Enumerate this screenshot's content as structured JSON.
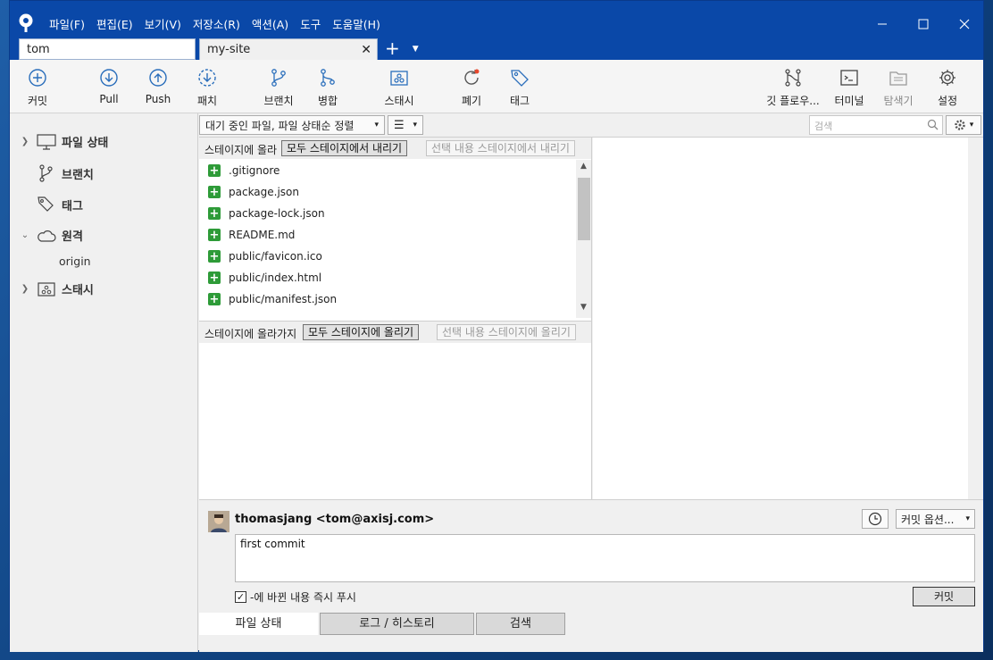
{
  "menu": [
    "파일(F)",
    "편집(E)",
    "보기(V)",
    "저장소(R)",
    "액션(A)",
    "도구",
    "도움말(H)"
  ],
  "tabs": [
    {
      "label": "tom"
    },
    {
      "label": "my-site"
    }
  ],
  "toolbar": {
    "commit": "커밋",
    "pull": "Pull",
    "push": "Push",
    "fetch": "패치",
    "branch": "브랜치",
    "merge": "병합",
    "stash": "스태시",
    "discard": "폐기",
    "tag": "태그",
    "git_flow": "깃 플로우...",
    "terminal": "터미널",
    "explorer": "탐색기",
    "settings": "설정"
  },
  "sidebar": {
    "file_status": "파일 상태",
    "branches": "브랜치",
    "tags": "태그",
    "remotes": "원격",
    "remote_origin": "origin",
    "stashes": "스태시"
  },
  "filter": {
    "sort_label": "대기 중인 파일, 파일 상태순 정렬",
    "search_placeholder": "검색"
  },
  "staged": {
    "title": "스테이지에 올라",
    "unstage_all": "모두 스테이지에서 내리기",
    "unstage_selected": "선택 내용 스테이지에서 내리기",
    "files": [
      ".gitignore",
      "package.json",
      "package-lock.json",
      "README.md",
      "public/favicon.ico",
      "public/index.html",
      "public/manifest.json"
    ]
  },
  "unstaged": {
    "title": "스테이지에 올라가지",
    "stage_all": "모두 스테이지에 올리기",
    "stage_selected": "선택 내용 스테이지에 올리기"
  },
  "commit": {
    "author": "thomasjang <tom@axisj.com>",
    "options": "커밋 옵션...",
    "message": "first commit",
    "push_immediately": "-에 바뀐 내용 즉시 푸시",
    "push_checked": true,
    "button": "커밋"
  },
  "bottom_tabs": [
    "파일 상태",
    "로그 / 히스토리",
    "검색"
  ]
}
